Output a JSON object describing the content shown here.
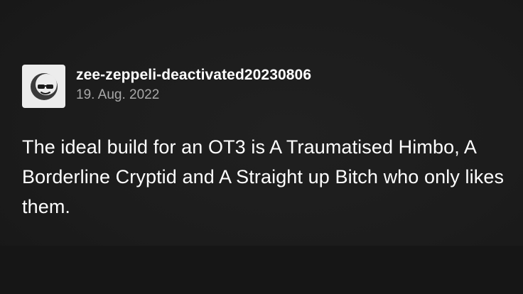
{
  "post": {
    "author": {
      "username": "zee-zeppeli-deactivated20230806",
      "avatar_icon": "sunglasses-face-icon"
    },
    "date": "19. Aug. 2022",
    "body": "The ideal build for an OT3 is A Traumatised Himbo, A Borderline Cryptid and A Straight up Bitch who only likes them."
  },
  "colors": {
    "background": "#1b1b1b",
    "text": "#ffffff",
    "date_text": "#a8a8a8",
    "avatar_bg": "#ececec"
  }
}
